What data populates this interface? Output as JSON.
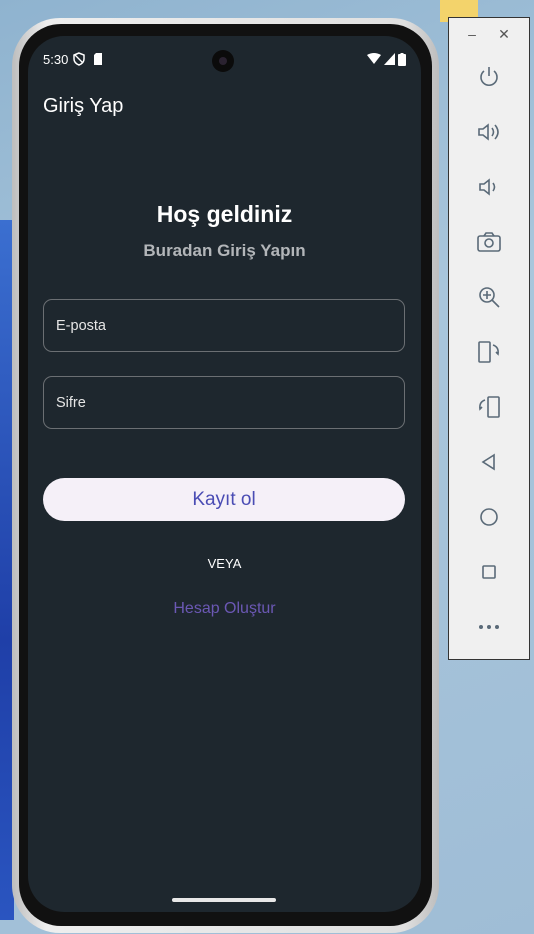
{
  "status_bar": {
    "time": "5:30"
  },
  "app_bar": {
    "title": "Giriş Yap"
  },
  "main": {
    "title": "Hoş geldiniz",
    "subtitle": "Buradan Giriş Yapın",
    "email_placeholder": "E-posta",
    "password_placeholder": "Sifre",
    "register_button": "Kayıt ol",
    "or_label": "VEYA",
    "create_account_link": "Hesap Oluştur"
  },
  "emulator_panel": {
    "minimize": "–",
    "close": "✕",
    "buttons": [
      "power-icon",
      "volume-up-icon",
      "volume-down-icon",
      "camera-icon",
      "zoom-icon",
      "rotate-left-icon",
      "rotate-right-icon",
      "back-icon",
      "home-icon",
      "overview-icon",
      "more-icon"
    ]
  },
  "colors": {
    "screen_bg": "#1e272e",
    "button_bg": "#f5f0f8",
    "button_text": "#4a4cb4",
    "link": "#6b58b4"
  }
}
